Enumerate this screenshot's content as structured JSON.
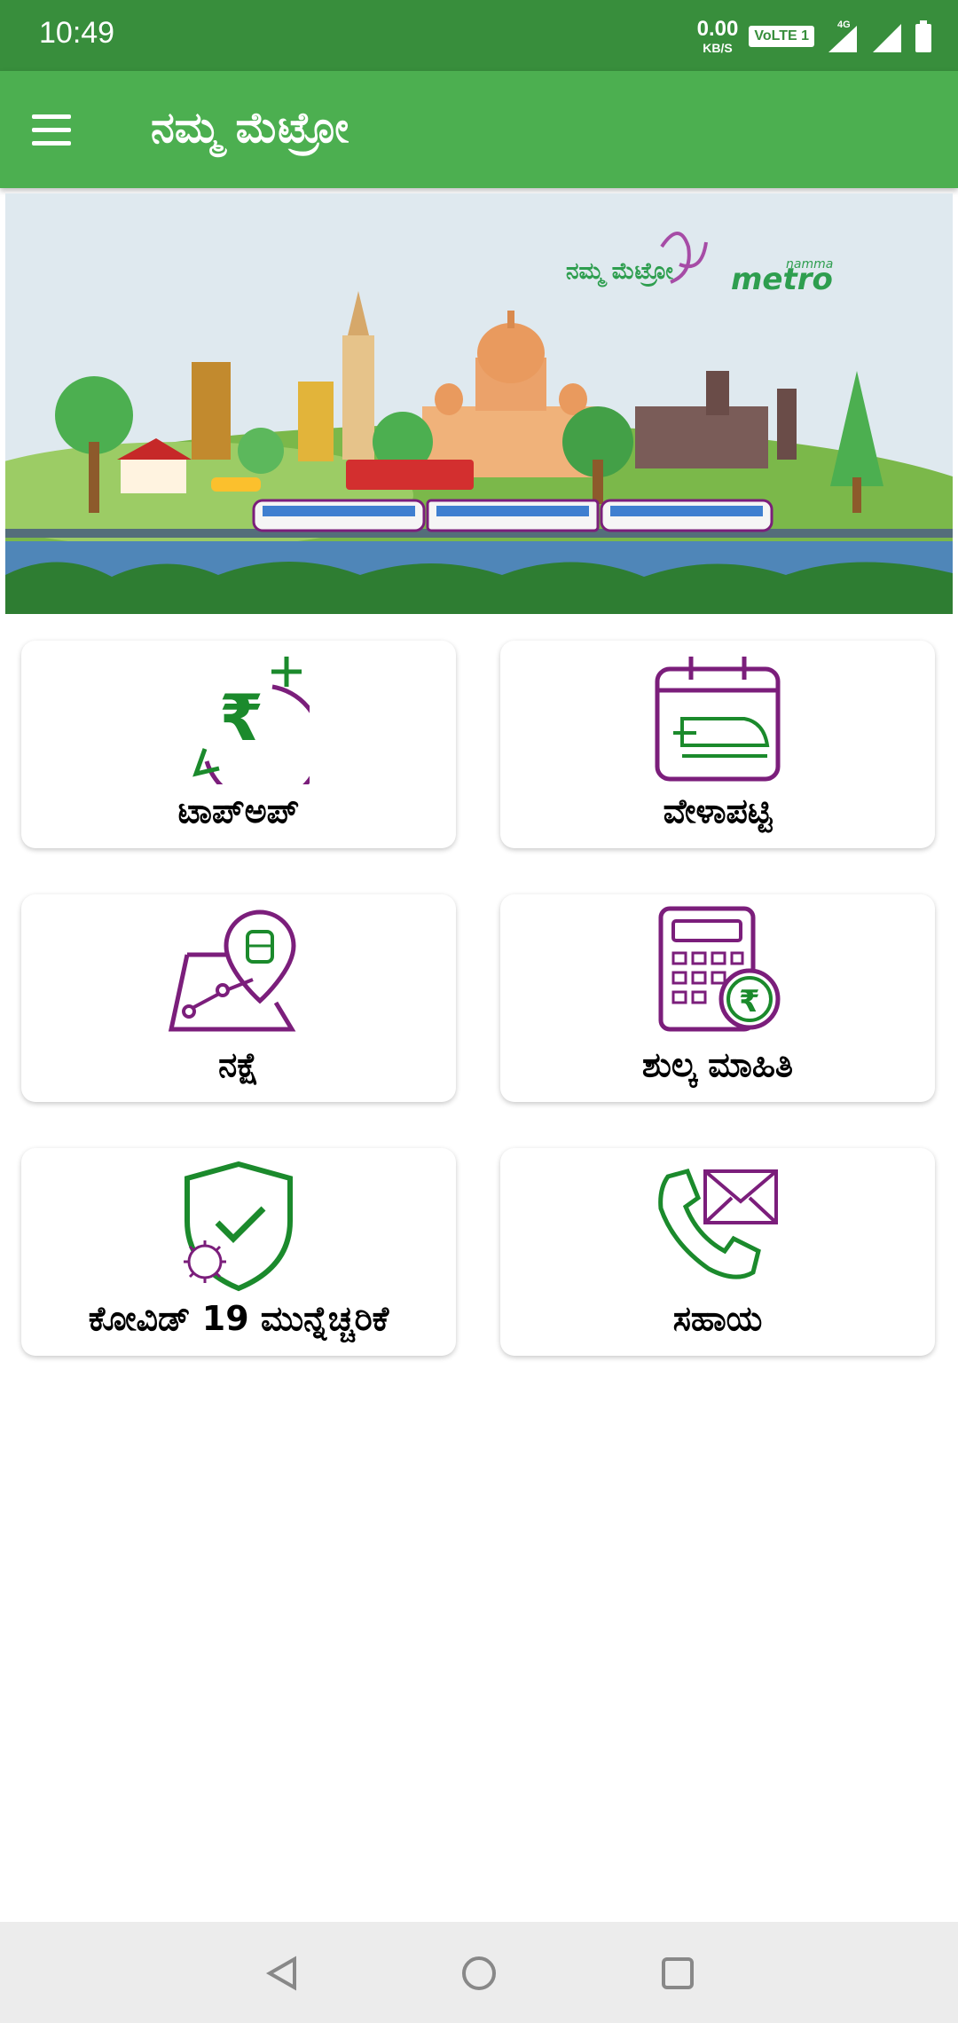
{
  "status_bar": {
    "time": "10:49",
    "speed_value": "0.00",
    "speed_unit": "KB/S",
    "volte": "VoLTE 1",
    "network": "4G"
  },
  "app_bar": {
    "title": "ನಮ್ಮ ಮೆಟ್ರೋ",
    "menu_icon": "hamburger-menu-icon"
  },
  "banner": {
    "logo_kannada": "ನಮ್ಮ ಮೆಟ್ರೋ",
    "logo_small": "namma",
    "logo_main": "metro"
  },
  "tiles": [
    {
      "label": "ಟಾಪ್ಅಪ್",
      "icon": "rupee-topup-icon"
    },
    {
      "label": "ವೇಳಾಪಟ್ಟಿ",
      "icon": "train-calendar-icon"
    },
    {
      "label": "ನಕ್ಷೆ",
      "icon": "metro-map-icon"
    },
    {
      "label": "ಶುಲ್ಕ ಮಾಹಿತಿ",
      "icon": "fare-calculator-icon"
    },
    {
      "label": "ಕೋವಿಡ್ 19 ಮುನ್ನೆಚ್ಚರಿಕೆ",
      "icon": "covid-shield-icon"
    },
    {
      "label": "ಸಹಾಯ",
      "icon": "phone-mail-icon"
    }
  ],
  "colors": {
    "primary_green": "#4caf50",
    "status_green": "#388e3c",
    "icon_purple": "#7b1e7b",
    "icon_green": "#1b8a2c"
  },
  "nav_bar": {
    "back": "back-icon",
    "home": "home-icon",
    "recents": "recents-icon"
  }
}
